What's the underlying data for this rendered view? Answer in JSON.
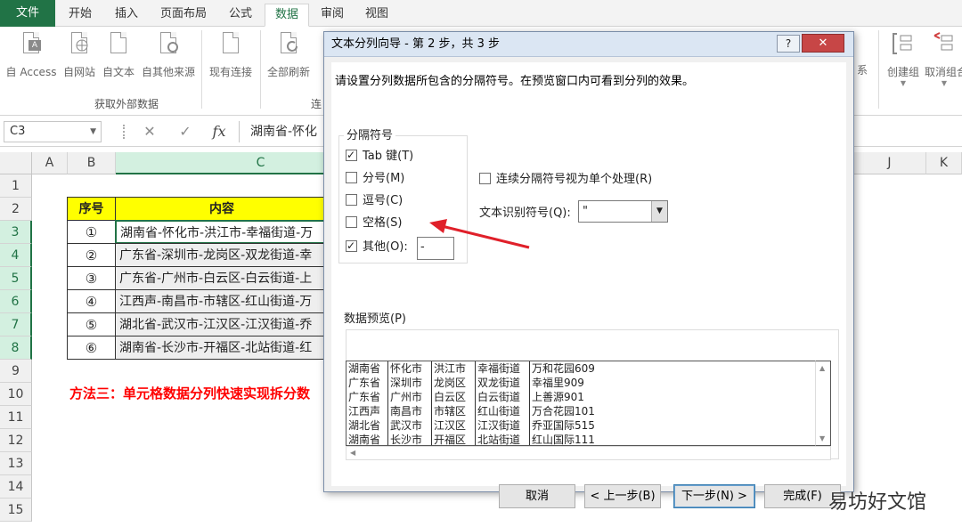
{
  "tabs": [
    "文件",
    "开始",
    "插入",
    "页面布局",
    "公式",
    "数据",
    "审阅",
    "视图"
  ],
  "ribbon": {
    "buttons_left": [
      "自 Access",
      "自网站",
      "自文本",
      "自其他来源",
      "现有连接",
      "全部刷新"
    ],
    "buttons_right": [
      "创建组",
      "取消组合"
    ],
    "partial_labels": [
      "连",
      "系"
    ],
    "group_label": "获取外部数据",
    "access_badge": "A"
  },
  "formula_bar": {
    "name_box": "C3",
    "cancel": "✕",
    "enter": "✓",
    "fx": "fx",
    "content": "湖南省-怀化"
  },
  "grid": {
    "columns": [
      "A",
      "B",
      "C",
      "J",
      "K"
    ],
    "rows": [
      "1",
      "2",
      "3",
      "4",
      "5",
      "6",
      "7",
      "8",
      "9",
      "10",
      "11",
      "12",
      "13",
      "14",
      "15"
    ],
    "header": {
      "num": "序号",
      "content": "内容"
    },
    "data": [
      {
        "num": "①",
        "content": "湖南省-怀化市-洪江市-幸福街道-万"
      },
      {
        "num": "②",
        "content": "广东省-深圳市-龙岗区-双龙街道-幸"
      },
      {
        "num": "③",
        "content": "广东省-广州市-白云区-白云街道-上"
      },
      {
        "num": "④",
        "content": "江西声-南昌市-市辖区-红山街道-万"
      },
      {
        "num": "⑤",
        "content": "湖北省-武汉市-江汉区-江汉街道-乔"
      },
      {
        "num": "⑥",
        "content": "湖南省-长沙市-开福区-北站街道-红"
      }
    ],
    "note": "方法三：单元格数据分列快速实现拆分数"
  },
  "dialog": {
    "title": "文本分列向导 - 第 2 步，共 3 步",
    "help": "?",
    "close": "✕",
    "instruction": "请设置分列数据所包含的分隔符号。在预览窗口内可看到分列的效果。",
    "delimiter_group": "分隔符号",
    "delimiters": [
      {
        "label": "Tab 键(T)",
        "checked": true
      },
      {
        "label": "分号(M)",
        "checked": false
      },
      {
        "label": "逗号(C)",
        "checked": false
      },
      {
        "label": "空格(S)",
        "checked": false
      },
      {
        "label": "其他(O):",
        "checked": true
      }
    ],
    "other_value": "-",
    "consecutive_label": "连续分隔符号视为单个处理(R)",
    "qualifier_label": "文本识别符号(Q):",
    "qualifier_value": "\"",
    "preview_label": "数据预览(P)",
    "preview_rows": [
      [
        "湖南省",
        "怀化市",
        "洪江市",
        "幸福街道",
        "万和花园609"
      ],
      [
        "广东省",
        "深圳市",
        "龙岗区",
        "双龙街道",
        "幸福里909"
      ],
      [
        "广东省",
        "广州市",
        "白云区",
        "白云街道",
        "上善源901"
      ],
      [
        "江西声",
        "南昌市",
        "市辖区",
        "红山街道",
        "万合花园101"
      ],
      [
        "湖北省",
        "武汉市",
        "江汉区",
        "江汉街道",
        "乔亚国际515"
      ],
      [
        "湖南省",
        "长沙市",
        "开福区",
        "北站街道",
        "红山国际111"
      ]
    ],
    "buttons": {
      "cancel": "取消",
      "back": "< 上一步(B)",
      "next": "下一步(N) >",
      "finish": "完成(F)"
    }
  },
  "watermark": "易坊好文馆",
  "colors": {
    "excel_green": "#217346",
    "header_yellow": "#ffff00",
    "note_red": "#ff0000",
    "arrow_red": "#e0202a"
  }
}
